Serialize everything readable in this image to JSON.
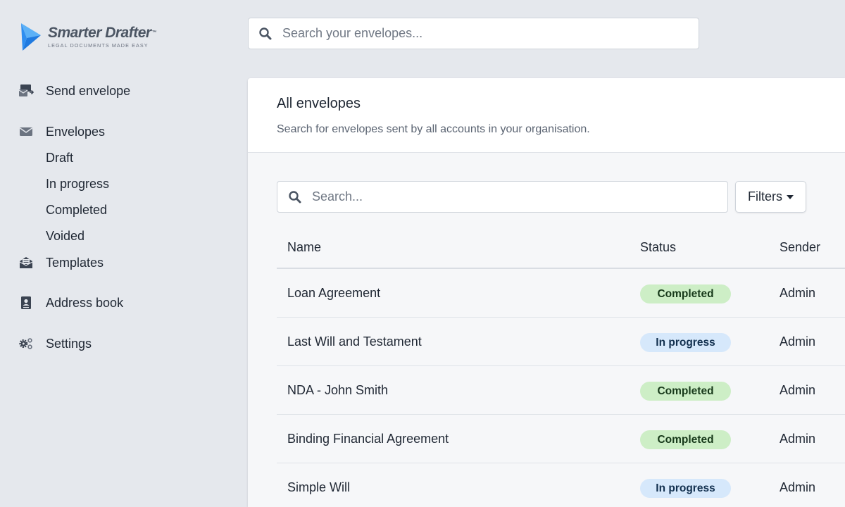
{
  "brand": {
    "name": "Smarter Drafter",
    "trademark": "™",
    "tagline": "LEGAL DOCUMENTS MADE EASY"
  },
  "top_search": {
    "placeholder": "Search your envelopes..."
  },
  "sidebar": {
    "send_envelope": "Send envelope",
    "envelopes": "Envelopes",
    "envelope_subitems": [
      "Draft",
      "In progress",
      "Completed",
      "Voided"
    ],
    "templates": "Templates",
    "address_book": "Address book",
    "settings": "Settings"
  },
  "main": {
    "title": "All envelopes",
    "subtitle": "Search for envelopes sent by all accounts in your organisation.",
    "search_placeholder": "Search...",
    "filters_label": "Filters",
    "columns": [
      "Name",
      "Status",
      "Sender"
    ],
    "rows": [
      {
        "name": "Loan Agreement",
        "status": "Completed",
        "sender": "Admin"
      },
      {
        "name": "Last Will and Testament",
        "status": "In progress",
        "sender": "Admin"
      },
      {
        "name": "NDA - John Smith",
        "status": "Completed",
        "sender": "Admin"
      },
      {
        "name": "Binding Financial Agreement",
        "status": "Completed",
        "sender": "Admin"
      },
      {
        "name": "Simple Will",
        "status": "In progress",
        "sender": "Admin"
      }
    ]
  },
  "colors": {
    "brand_blue": "#2f8ef0",
    "completed_bg": "#cdeec6",
    "in_progress_bg": "#d6e8fb",
    "page_bg": "#e5e8ed"
  }
}
